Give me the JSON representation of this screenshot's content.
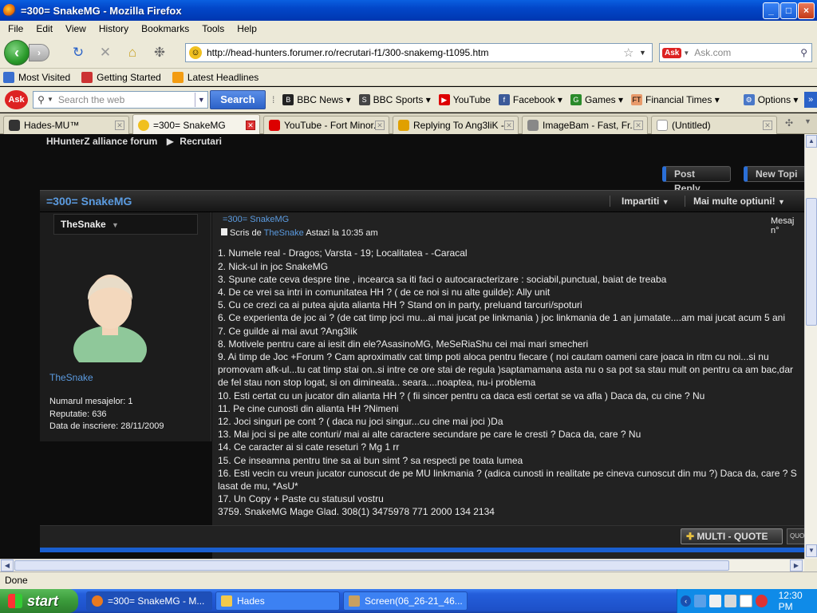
{
  "window": {
    "title": "=300= SnakeMG - Mozilla Firefox",
    "controls": [
      "_",
      "□",
      "×"
    ]
  },
  "menu": [
    "File",
    "Edit",
    "View",
    "History",
    "Bookmarks",
    "Tools",
    "Help"
  ],
  "nav": {
    "url": "http://head-hunters.forumer.ro/recrutari-f1/300-snakemg-t1095.htm",
    "search_placeholder": "Ask.com"
  },
  "bookmarks": [
    {
      "label": "Most Visited",
      "icon": "bookmark-folder-icon",
      "color": "#3a6fcf"
    },
    {
      "label": "Getting Started",
      "icon": "firefox-icon",
      "color": "#c33"
    },
    {
      "label": "Latest Headlines",
      "icon": "rss-icon",
      "color": "#f39c12"
    }
  ],
  "toolbar": {
    "search_placeholder": "Search the web",
    "search_button": "Search",
    "items": [
      {
        "label": "BBC News",
        "icon": "bbc-icon",
        "color": "#222",
        "dropdown": true
      },
      {
        "label": "BBC Sports",
        "icon": "bbc-sports-icon",
        "color": "#444",
        "dropdown": true
      },
      {
        "label": "YouTube",
        "icon": "youtube-icon",
        "color": "#d00",
        "dropdown": false
      },
      {
        "label": "Facebook",
        "icon": "facebook-icon",
        "color": "#3b5998",
        "dropdown": true
      },
      {
        "label": "Games",
        "icon": "games-icon",
        "color": "#2a8a2a",
        "dropdown": true
      },
      {
        "label": "Financial Times",
        "icon": "ft-icon",
        "color": "#e89a6a",
        "dropdown": true
      }
    ],
    "options": "Options"
  },
  "tabs": [
    {
      "label": "Hades-MU™",
      "color": "#333",
      "active": false
    },
    {
      "label": "=300= SnakeMG",
      "color": "#f0c020",
      "active": true
    },
    {
      "label": "YouTube - Fort Minor...",
      "color": "#d00",
      "active": false
    },
    {
      "label": "Replying To Ang3liK -...",
      "color": "#e0a000",
      "active": false
    },
    {
      "label": "ImageBam - Fast, Fr...",
      "color": "#888",
      "active": false
    },
    {
      "label": "(Untitled)",
      "color": "#fff",
      "active": false
    }
  ],
  "forum": {
    "breadcrumb_home": "HHunterZ alliance forum",
    "breadcrumb_sep": "▶",
    "breadcrumb_section": "Recrutari",
    "post_reply": "Post Reply",
    "new_topic": "New Topi",
    "thread_title": "=300= SnakeMG",
    "share": "Impartiti",
    "more_options": "Mai multe optiuni!",
    "username": "TheSnake",
    "user_link": "TheSnake",
    "stats": [
      "Numarul mesajelor: 1",
      "Reputatie: 636",
      "Data de inscriere: 28/11/2009"
    ],
    "post_subject": "=300= SnakeMG",
    "post_by": "Scris de",
    "post_author": "TheSnake",
    "post_time": "Astazi la 10:35 am",
    "post_num": "Mesaj n°",
    "lines": [
      "1. Numele real - Dragos; Varsta - 19; Localitatea - -Caracal",
      "2. Nick-ul in joc SnakeMG",
      "3. Spune cate ceva despre tine , incearca sa iti faci o autocaracterizare : sociabil,punctual, baiat de treaba",
      "4. De ce vrei sa intri in comunitatea HH ? ( de ce noi si nu alte guilde): Ally unit",
      "5. Cu ce crezi ca ai putea ajuta alianta HH ? Stand on in party, preluand tarcuri/spoturi",
      "6. Ce experienta de joc ai ? (de cat timp joci mu...ai mai jucat pe linkmania ) joc linkmania de 1 an jumatate....am mai jucat acum 5 ani",
      "7. Ce guilde ai mai avut ?Ang3lik",
      "8. Motivele pentru care ai iesit din ele?AsasinoMG, MeSeRiaShu cei mai mari smecheri",
      "9. Ai timp de Joc +Forum ? Cam aproximativ cat timp poti aloca pentru fiecare ( noi cautam oameni care joaca in ritm cu noi...si nu",
      "promovam afk-ul...tu cat timp stai on..si intre ce ore stai de regula )saptamamana asta nu o sa pot sa stau mult on pentru ca am bac,dar",
      "de fel stau non stop logat, si on dimineata.. seara....noaptea, nu-i problema",
      "10. Esti certat cu un jucator din alianta HH ? ( fii sincer pentru ca daca esti certat se va afla ) Daca da, cu cine ? Nu",
      "11. Pe cine cunosti din alianta HH ?Nimeni",
      "12. Joci singuri pe cont ? ( daca nu joci singur...cu cine mai joci )Da",
      "13. Mai joci si pe alte conturi/ mai ai alte caractere secundare pe care le cresti ? Daca da, care ? Nu",
      "14. Ce caracter ai si cate reseturi ? Mg 1 rr",
      "15. Ce inseamna pentru tine sa ai bun simt ? sa respecti pe toata lumea",
      "16. Esti vecin cu vreun jucator cunoscut de pe MU linkmania ? (adica cunosti in realitate pe cineva cunoscut din mu ?) Daca da, care ? S",
      "lasat de mu, *AsU*",
      "17. Un Copy + Paste cu statusul vostru",
      "3759. SnakeMG Mage Glad. 308(1) 3475978 771 2000 134 2134"
    ],
    "multi_quote": "MULTI - QUOTE",
    "quote": "QUO"
  },
  "status": "Done",
  "taskbar": {
    "start": "start",
    "tasks": [
      {
        "label": "=300= SnakeMG - M...",
        "icon": "firefox-icon",
        "color": "#e87a20",
        "active": true
      },
      {
        "label": "Hades",
        "icon": "folder-icon",
        "color": "#f2c94c",
        "active": false
      },
      {
        "label": "Screen(06_26-21_46...",
        "icon": "image-icon",
        "color": "#c8a060",
        "active": false
      }
    ],
    "clock": "12:30 PM"
  }
}
